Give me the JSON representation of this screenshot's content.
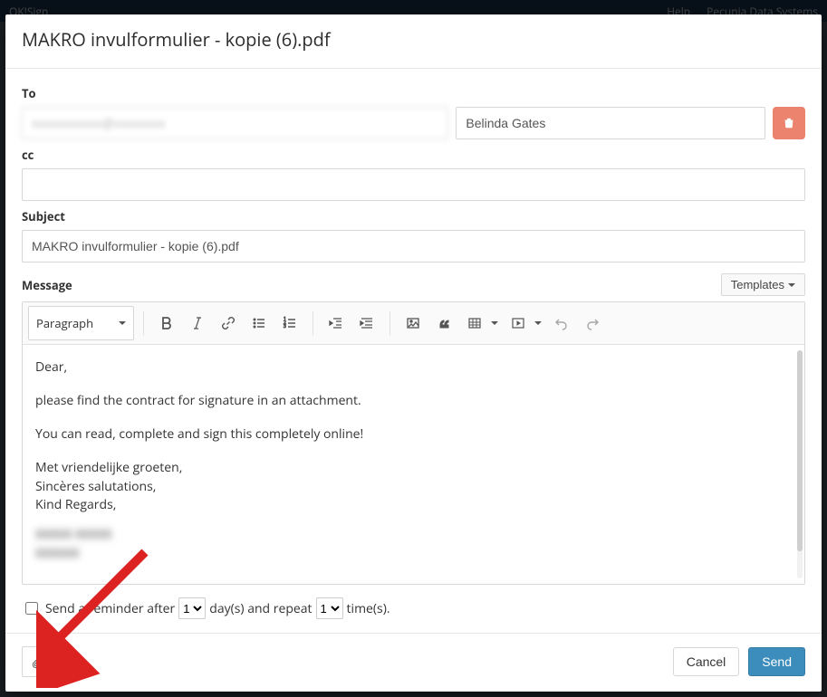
{
  "app": {
    "brand": "OK!Sign",
    "help": "Help",
    "tenant": "Pecunia Data Systems"
  },
  "modal": {
    "title": "MAKRO invulformulier - kopie (6).pdf",
    "labels": {
      "to": "To",
      "cc": "cc",
      "subject": "Subject",
      "message": "Message"
    },
    "to": {
      "email": "xxxxxxxxxxx@xxxxxxxx",
      "name": "Belinda Gates"
    },
    "cc": "",
    "subject": "MAKRO invulformulier - kopie (6).pdf",
    "templates_label": "Templates",
    "editor": {
      "paragraph_style": "Paragraph",
      "body": {
        "p1": "Dear,",
        "p2": "please find the contract for signature in an attachment.",
        "p3": "You can read, complete and sign this completely online!",
        "sig1": "Met vriendelijke groeten,",
        "sig2": "Sincères salutations,",
        "sig3": "Kind Regards,",
        "sig_name": "XXXXX XXXXX",
        "sig_title": "XXXXXX"
      }
    },
    "reminder": {
      "label_before": "Send a reminder after",
      "days_value": "1",
      "days_unit": "day(s) and repeat",
      "times_value": "1",
      "times_unit": "time(s)."
    },
    "footer": {
      "cancel": "Cancel",
      "send": "Send"
    }
  }
}
